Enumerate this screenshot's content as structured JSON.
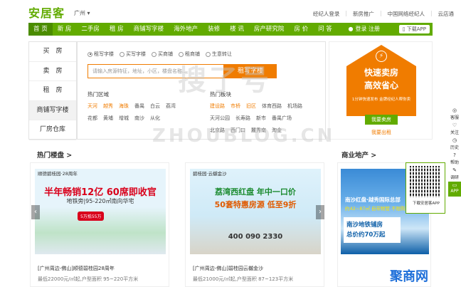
{
  "header": {
    "logo": "安居客",
    "city": "广州",
    "links": [
      "经纪人登录",
      "新房推广",
      "中国网络经纪人",
      "云店通"
    ]
  },
  "nav": {
    "items": [
      "首 页",
      "新 房",
      "二手房",
      "租 房",
      "商铺写字楼",
      "海外地产",
      "装修",
      "楼 讯",
      "房产研究院",
      "房 价",
      "问 答"
    ],
    "login": "登录 注册",
    "app": "下载APP"
  },
  "left_nav": [
    "买　房",
    "卖　房",
    "租　房",
    "商铺写字楼",
    "厂房仓库"
  ],
  "search": {
    "radios": [
      "租写字楼",
      "买写字楼",
      "买商铺",
      "租商铺",
      "生意转让"
    ],
    "placeholder": "请输入房源特征，地址，小区，楼盘名称...",
    "button": "租写字楼",
    "hot_area_title": "热门区域",
    "hot_areas": [
      [
        "天河",
        "越秀",
        "海珠",
        "番禺",
        "白云",
        "荔湾"
      ],
      [
        "花都",
        "黄埔",
        "增城",
        "南沙",
        "从化"
      ]
    ],
    "hot_block_title": "热门板块",
    "hot_blocks": [
      [
        "建设路",
        "市桥",
        "旧区",
        "体育西路",
        "机场路"
      ],
      [
        "天河公园",
        "长寿路",
        "新市",
        "番禺广场"
      ],
      [
        "北京路",
        "西门口",
        "麓秀南",
        "淘金"
      ]
    ]
  },
  "banner": {
    "line1": "快速卖房",
    "line2": "高效省心",
    "line3": "1分钟快速发布 金牌经纪人帮你卖",
    "sell": "我要卖房",
    "rent": "我要出租"
  },
  "sections": {
    "hot": "热门楼盘 >",
    "business": "商业地产 >"
  },
  "cards": [
    {
      "header": "顺德碧桂园·28周年",
      "headline": "半年畅销12亿 60席即收官",
      "sub": "地铁旁|95-220㎡南向华宅",
      "badge": "5万抵55万",
      "name": "[广州周边-佛山]顺德碧桂园28周年",
      "price": "最低22000元/㎡起,户型面积 95~220平方米"
    },
    {
      "header": "碧桂园·云樾金沙",
      "headline": "荔湾西红盘 年中一口价",
      "sub": "50套特惠房源 低至9折",
      "tel": "400 090 2330",
      "name": "[广州周边-佛山]碧桂园云樾金沙",
      "price": "最低21000元/㎡起,户型面积 87~123平方米"
    }
  ],
  "biz_card": {
    "line1": "南沙红盘·越秀国际总部",
    "line2": "约42~87㎡ 自带物管 不限购",
    "box1": "南沙地铁铺房",
    "box2": "总价约70万起"
  },
  "qr": {
    "label": "下载安居客APP"
  },
  "sidebar": [
    {
      "icon": "◎",
      "label": "客服"
    },
    {
      "icon": "♡",
      "label": "关注"
    },
    {
      "icon": "◷",
      "label": "历史"
    },
    {
      "icon": "?",
      "label": "帮助"
    },
    {
      "icon": "✎",
      "label": "调研"
    },
    {
      "icon": "▭",
      "label": "APP"
    }
  ],
  "watermarks": [
    "搜了号",
    "ZHOUBLOG.CN",
    "聚商网"
  ],
  "colors": {
    "brand_green": "#62ab00",
    "accent_orange": "#f07c00"
  }
}
